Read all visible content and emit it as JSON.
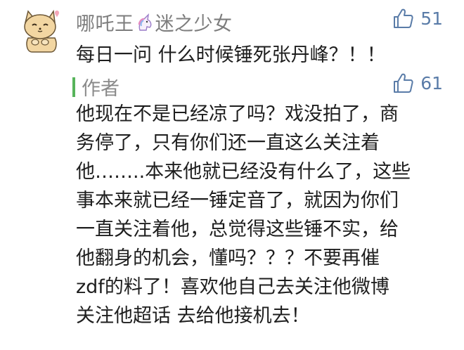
{
  "comment": {
    "username": "哪吒王",
    "username_suffix": "迷之少女",
    "username_badge": "unicorn-icon",
    "text": "每日一问 什么时候锤死张丹峰？！！",
    "likes": "51"
  },
  "reply": {
    "author_label": "作者",
    "likes": "61",
    "lines": [
      "他现在不是已经凉了吗？戏没拍了，商",
      "务停了，只有你们还一直这么关注着",
      "他……..本来他就已经没有什么了，这些",
      "事本来就已经一锤定音了，就因为你们",
      "一直关注着他，总觉得这些锤不实，给",
      "他翻身的机会，懂吗？？？不要再催",
      "zdf的料了！喜欢他自己去关注他微博",
      "关注他超话 去给他接机去！"
    ]
  },
  "colors": {
    "username": "#7d7d7d",
    "like": "#5a7ca8",
    "author_bar": "#57b45b",
    "text": "#1e1e1e"
  }
}
